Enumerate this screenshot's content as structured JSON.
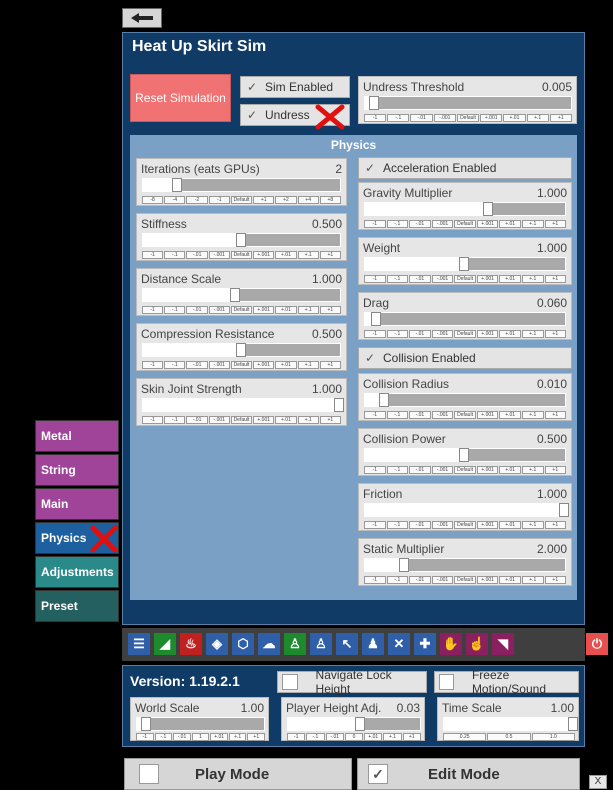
{
  "title": "Heat Up Skirt Sim",
  "reset_label": "Reset Simulation",
  "top": {
    "sim_enabled": "Sim Enabled",
    "undress": "Undress",
    "undress_threshold": {
      "label": "Undress Threshold",
      "value": "0.005",
      "level": 0.05
    }
  },
  "physics_title": "Physics",
  "left_params": [
    {
      "label": "Iterations (eats GPUs)",
      "value": "2",
      "level": 0.18,
      "steps": [
        "-8",
        "-4",
        "-2",
        "-1",
        "Default",
        "+1",
        "+2",
        "+4",
        "+8"
      ]
    },
    {
      "label": "Stiffness",
      "value": "0.500",
      "level": 0.5,
      "steps": [
        "-1",
        "-.1",
        "-.01",
        "-.001",
        "Default",
        "+.001",
        "+.01",
        "+.1",
        "+1"
      ]
    },
    {
      "label": "Distance Scale",
      "value": "1.000",
      "level": 0.47,
      "steps": [
        "-1",
        "-.1",
        "-.01",
        "-.001",
        "Default",
        "+.001",
        "+.01",
        "+.1",
        "+1"
      ]
    },
    {
      "label": "Compression Resistance",
      "value": "0.500",
      "level": 0.5,
      "steps": [
        "-1",
        "-.1",
        "-.01",
        "-.001",
        "Default",
        "+.001",
        "+.01",
        "+.1",
        "+1"
      ]
    },
    {
      "label": "Skin Joint Strength",
      "value": "1.000",
      "level": 1.0,
      "steps": [
        "-1",
        "-.1",
        "-.01",
        "-.001",
        "Default",
        "+.001",
        "+.01",
        "+.1",
        "+1"
      ]
    }
  ],
  "accel_enabled": "Acceleration Enabled",
  "collision_enabled": "Collision Enabled",
  "right_params_a": [
    {
      "label": "Gravity Multiplier",
      "value": "1.000",
      "level": 0.62,
      "steps": [
        "-1",
        "-.1",
        "-.01",
        "-.001",
        "Default",
        "+.001",
        "+.01",
        "+.1",
        "+1"
      ]
    },
    {
      "label": "Weight",
      "value": "1.000",
      "level": 0.5,
      "steps": [
        "-1",
        "-.1",
        "-.01",
        "-.001",
        "Default",
        "+.001",
        "+.01",
        "+.1",
        "+1"
      ]
    },
    {
      "label": "Drag",
      "value": "0.060",
      "level": 0.06,
      "steps": [
        "-1",
        "-.1",
        "-.01",
        "-.001",
        "Default",
        "+.001",
        "+.01",
        "+.1",
        "+1"
      ]
    }
  ],
  "right_params_b": [
    {
      "label": "Collision Radius",
      "value": "0.010",
      "level": 0.1,
      "steps": [
        "-1",
        "-.1",
        "-.01",
        "-.001",
        "Default",
        "+.001",
        "+.01",
        "+.1",
        "+1"
      ]
    },
    {
      "label": "Collision Power",
      "value": "0.500",
      "level": 0.5,
      "steps": [
        "-1",
        "-.1",
        "-.01",
        "-.001",
        "Default",
        "+.001",
        "+.01",
        "+.1",
        "+1"
      ]
    },
    {
      "label": "Friction",
      "value": "1.000",
      "level": 1.0,
      "steps": [
        "-1",
        "-.1",
        "-.01",
        "-.001",
        "Default",
        "+.001",
        "+.01",
        "+.1",
        "+1"
      ]
    },
    {
      "label": "Static Multiplier",
      "value": "2.000",
      "level": 0.2,
      "steps": [
        "-1",
        "-.1",
        "-.01",
        "-.001",
        "Default",
        "+.001",
        "+.01",
        "+.1",
        "+1"
      ]
    }
  ],
  "tabs": [
    {
      "label": "Metal",
      "color": "#a0449a"
    },
    {
      "label": "String",
      "color": "#a0449a"
    },
    {
      "label": "Main",
      "color": "#a0449a"
    },
    {
      "label": "Physics",
      "color": "#1e5fa0"
    },
    {
      "label": "Adjustments",
      "color": "#2a8a8a"
    },
    {
      "label": "Preset",
      "color": "#246060"
    }
  ],
  "toolbar_icons": [
    {
      "name": "menu-icon",
      "glyph": "☰",
      "color": "#2f5fa8"
    },
    {
      "name": "paint-icon",
      "glyph": "◢",
      "color": "#1e8a2e"
    },
    {
      "name": "bath-icon",
      "glyph": "♨",
      "color": "#c02020"
    },
    {
      "name": "cube-icon",
      "glyph": "◈",
      "color": "#2f5fa8"
    },
    {
      "name": "box-icon",
      "glyph": "⬡",
      "color": "#2f5fa8"
    },
    {
      "name": "cloud-icon",
      "glyph": "☁",
      "color": "#2f5fa8"
    },
    {
      "name": "person-settings-icon",
      "glyph": "♙",
      "color": "#1e8a2e"
    },
    {
      "name": "person-edit-icon",
      "glyph": "♙",
      "color": "#2f5fa8"
    },
    {
      "name": "cursor-icon",
      "glyph": "↖",
      "color": "#2f5fa8"
    },
    {
      "name": "people-icon",
      "glyph": "♟",
      "color": "#2f5fa8"
    },
    {
      "name": "tools-icon",
      "glyph": "✕",
      "color": "#2f5fa8"
    },
    {
      "name": "plus-icon",
      "glyph": "✚",
      "color": "#2f5fa8"
    },
    {
      "name": "hand-icon",
      "glyph": "✋",
      "color": "#8a2060"
    },
    {
      "name": "pointer-hand-icon",
      "glyph": "☝",
      "color": "#8a2060"
    },
    {
      "name": "tag-icon",
      "glyph": "◥",
      "color": "#8a2060"
    },
    {
      "name": "power-icon",
      "glyph": "⏻",
      "color": "#e85050"
    }
  ],
  "version": "Version: 1.19.2.1",
  "navigate_lock": "Navigate Lock Height",
  "freeze": "Freeze Motion/Sound",
  "world_scale": {
    "label": "World Scale",
    "value": "1.00",
    "level": 0.08,
    "steps": [
      "-1",
      "-.1",
      "-.01",
      "1",
      "+.01",
      "+.1",
      "+1"
    ]
  },
  "player_height": {
    "label": "Player Height Adj.",
    "value": "0.03",
    "level": 0.55,
    "steps": [
      "-1",
      "-.1",
      "-.01",
      "0",
      "+.01",
      "+.1",
      "+1"
    ]
  },
  "time_scale": {
    "label": "Time Scale",
    "value": "1.00",
    "level": 1.0,
    "steps": [
      "0.25",
      "0.5",
      "1.0"
    ]
  },
  "play_mode": "Play Mode",
  "edit_mode": "Edit Mode",
  "close_x": "X"
}
